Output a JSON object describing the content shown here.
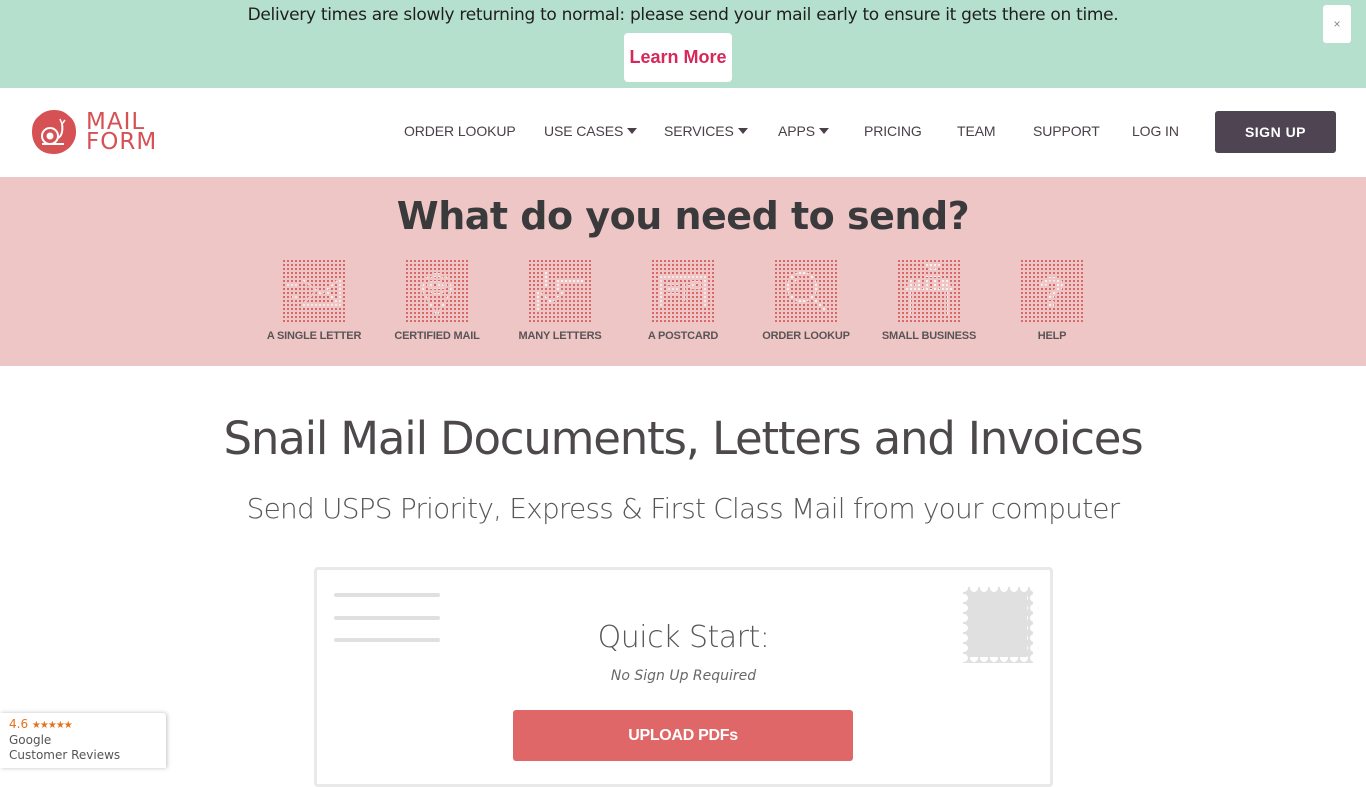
{
  "alert": {
    "message": "Delivery times are slowly returning to normal: please send your mail early to ensure it gets there on time.",
    "button_label": "Learn More",
    "close_label": "×"
  },
  "brand": {
    "line1": "MAIL",
    "line2": "FORM",
    "accent_color": "#d65154"
  },
  "nav": {
    "items": [
      {
        "label": "ORDER LOOKUP",
        "dropdown": false
      },
      {
        "label": "USE CASES",
        "dropdown": true
      },
      {
        "label": "SERVICES",
        "dropdown": true
      },
      {
        "label": "APPS",
        "dropdown": true
      },
      {
        "label": "PRICING",
        "dropdown": false
      },
      {
        "label": "TEAM",
        "dropdown": false
      },
      {
        "label": "SUPPORT",
        "dropdown": false
      },
      {
        "label": "LOG IN",
        "dropdown": false
      }
    ],
    "signup_label": "SIGN UP"
  },
  "band": {
    "title": "What do you need to send?",
    "tiles": [
      {
        "label": "A SINGLE LETTER",
        "icon": "envelope-icon"
      },
      {
        "label": "CERTIFIED MAIL",
        "icon": "location-pin-truck-icon"
      },
      {
        "label": "MANY LETTERS",
        "icon": "stacked-envelopes-icon"
      },
      {
        "label": "A POSTCARD",
        "icon": "postcard-icon"
      },
      {
        "label": "ORDER LOOKUP",
        "icon": "magnifier-icon"
      },
      {
        "label": "SMALL BUSINESS",
        "icon": "storefront-icon"
      },
      {
        "label": "HELP",
        "icon": "question-mark-icon"
      }
    ]
  },
  "hero": {
    "title": "Snail Mail Documents, Letters and Invoices",
    "subtitle": "Send USPS Priority, Express & First Class Mail from your computer"
  },
  "quick_start": {
    "title": "Quick Start:",
    "subtitle": "No Sign Up Required",
    "button_label": "UPLOAD PDFs"
  },
  "google_reviews": {
    "rating": "4.6",
    "stars": "★★★★★",
    "line1": "Google",
    "line2": "Customer Reviews"
  }
}
